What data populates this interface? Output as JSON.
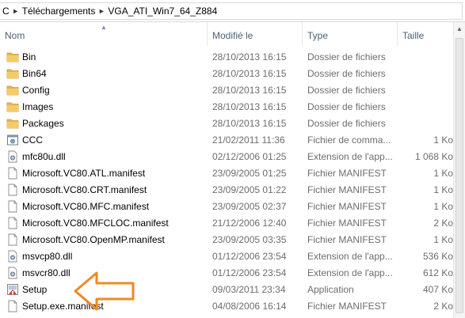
{
  "breadcrumb": {
    "items": [
      "C",
      "Téléchargements",
      "VGA_ATI_Win7_64_Z884"
    ]
  },
  "columns": {
    "name": "Nom",
    "modified": "Modifié le",
    "type": "Type",
    "size": "Taille"
  },
  "files": [
    {
      "name": "Bin",
      "modified": "28/10/2013 16:15",
      "type": "Dossier de fichiers",
      "size": "",
      "icon": "folder-icon"
    },
    {
      "name": "Bin64",
      "modified": "28/10/2013 16:15",
      "type": "Dossier de fichiers",
      "size": "",
      "icon": "folder-icon"
    },
    {
      "name": "Config",
      "modified": "28/10/2013 16:15",
      "type": "Dossier de fichiers",
      "size": "",
      "icon": "folder-icon"
    },
    {
      "name": "Images",
      "modified": "28/10/2013 16:15",
      "type": "Dossier de fichiers",
      "size": "",
      "icon": "folder-icon"
    },
    {
      "name": "Packages",
      "modified": "28/10/2013 16:15",
      "type": "Dossier de fichiers",
      "size": "",
      "icon": "folder-icon"
    },
    {
      "name": "CCC",
      "modified": "21/02/2011 11:36",
      "type": "Fichier de comma...",
      "size": "1 Ko",
      "icon": "command-file-icon"
    },
    {
      "name": "mfc80u.dll",
      "modified": "02/12/2006 01:25",
      "type": "Extension de l'app...",
      "size": "1 068 Ko",
      "icon": "dll-file-icon"
    },
    {
      "name": "Microsoft.VC80.ATL.manifest",
      "modified": "23/09/2005 01:25",
      "type": "Fichier MANIFEST",
      "size": "1 Ko",
      "icon": "file-icon"
    },
    {
      "name": "Microsoft.VC80.CRT.manifest",
      "modified": "23/09/2005 01:22",
      "type": "Fichier MANIFEST",
      "size": "1 Ko",
      "icon": "file-icon"
    },
    {
      "name": "Microsoft.VC80.MFC.manifest",
      "modified": "23/09/2005 02:37",
      "type": "Fichier MANIFEST",
      "size": "1 Ko",
      "icon": "file-icon"
    },
    {
      "name": "Microsoft.VC80.MFCLOC.manifest",
      "modified": "21/12/2006 12:40",
      "type": "Fichier MANIFEST",
      "size": "2 Ko",
      "icon": "file-icon"
    },
    {
      "name": "Microsoft.VC80.OpenMP.manifest",
      "modified": "23/09/2005 03:35",
      "type": "Fichier MANIFEST",
      "size": "1 Ko",
      "icon": "file-icon"
    },
    {
      "name": "msvcp80.dll",
      "modified": "01/12/2006 23:54",
      "type": "Extension de l'app...",
      "size": "536 Ko",
      "icon": "dll-file-icon"
    },
    {
      "name": "msvcr80.dll",
      "modified": "01/12/2006 23:54",
      "type": "Extension de l'app...",
      "size": "612 Ko",
      "icon": "dll-file-icon"
    },
    {
      "name": "Setup",
      "modified": "09/03/2011 23:34",
      "type": "Application",
      "size": "407 Ko",
      "icon": "setup-app-icon"
    },
    {
      "name": "Setup.exe.manifest",
      "modified": "04/08/2006 16:14",
      "type": "Fichier MANIFEST",
      "size": "2 Ko",
      "icon": "file-icon"
    }
  ],
  "annotation": {
    "arrow_color": "#f08a24",
    "icon": "arrow-left-icon"
  },
  "colors": {
    "header_text": "#4c607a",
    "secondary_text": "#6d6d6d",
    "folder": "#e8b84a"
  }
}
